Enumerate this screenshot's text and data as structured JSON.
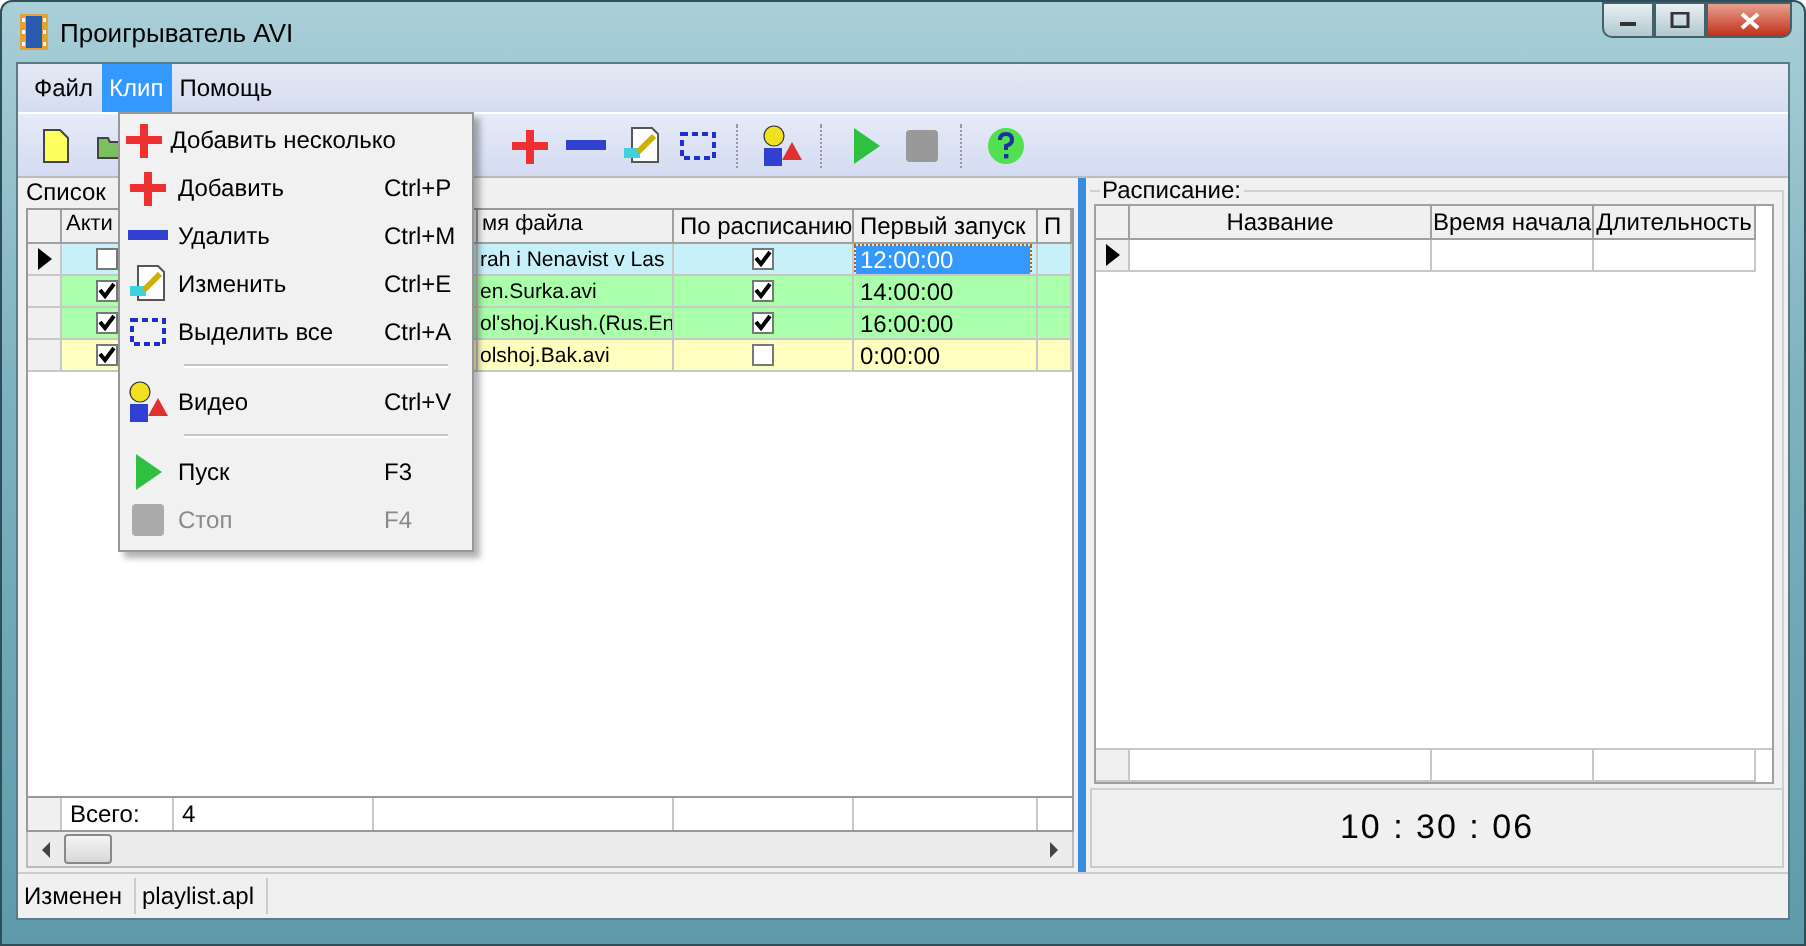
{
  "window": {
    "title": "Проигрыватель AVI"
  },
  "menu_bar": [
    {
      "label": "Файл",
      "selected": false
    },
    {
      "label": "Клип",
      "selected": true
    },
    {
      "label": "Помощь",
      "selected": false
    }
  ],
  "dropdown": [
    {
      "kind": "item",
      "label": "Добавить несколько",
      "disabled": false
    },
    {
      "kind": "item",
      "label": "Добавить",
      "shortcut": "Ctrl+P",
      "disabled": false
    },
    {
      "kind": "item",
      "label": "Удалить",
      "shortcut": "Ctrl+M",
      "disabled": false
    },
    {
      "kind": "item",
      "label": "Изменить",
      "shortcut": "Ctrl+E",
      "disabled": false
    },
    {
      "kind": "item",
      "label": "Выделить все",
      "shortcut": "Ctrl+A",
      "disabled": false
    },
    {
      "kind": "separator"
    },
    {
      "kind": "item",
      "label": "Видео",
      "shortcut": "Ctrl+V",
      "disabled": false
    },
    {
      "kind": "separator"
    },
    {
      "kind": "item",
      "label": "Пуск",
      "shortcut": "F3",
      "disabled": false
    },
    {
      "kind": "item",
      "label": "Стоп",
      "shortcut": "F4",
      "disabled": true
    }
  ],
  "playlist": {
    "label": "Список",
    "columns": [
      "Акти",
      "мя файла",
      "По расписанию",
      "Первый запуск",
      "П"
    ],
    "rows": [
      {
        "active": false,
        "file": "rah i Nenavist v Las",
        "scheduled": true,
        "first_run": "12:00:00",
        "selected": true,
        "color": "#c8f0f8"
      },
      {
        "active": true,
        "file": "en.Surka.avi",
        "scheduled": true,
        "first_run": "14:00:00",
        "selected": false,
        "color": "#aaffaa"
      },
      {
        "active": true,
        "file": "ol'shoj.Kush.(Rus.En",
        "scheduled": true,
        "first_run": "16:00:00",
        "selected": false,
        "color": "#aaffaa"
      },
      {
        "active": true,
        "file": "olshoj.Bak.avi",
        "scheduled": false,
        "first_run": "0:00:00",
        "selected": false,
        "color": "#ffffc0"
      }
    ],
    "footer": {
      "label": "Всего:",
      "value": "4"
    }
  },
  "schedule": {
    "title": "Расписание:",
    "columns": [
      "Название",
      "Время начала",
      "Длительность"
    ],
    "clock": "10 : 30 : 06"
  },
  "status_bar": [
    "Изменен",
    "playlist.apl"
  ]
}
